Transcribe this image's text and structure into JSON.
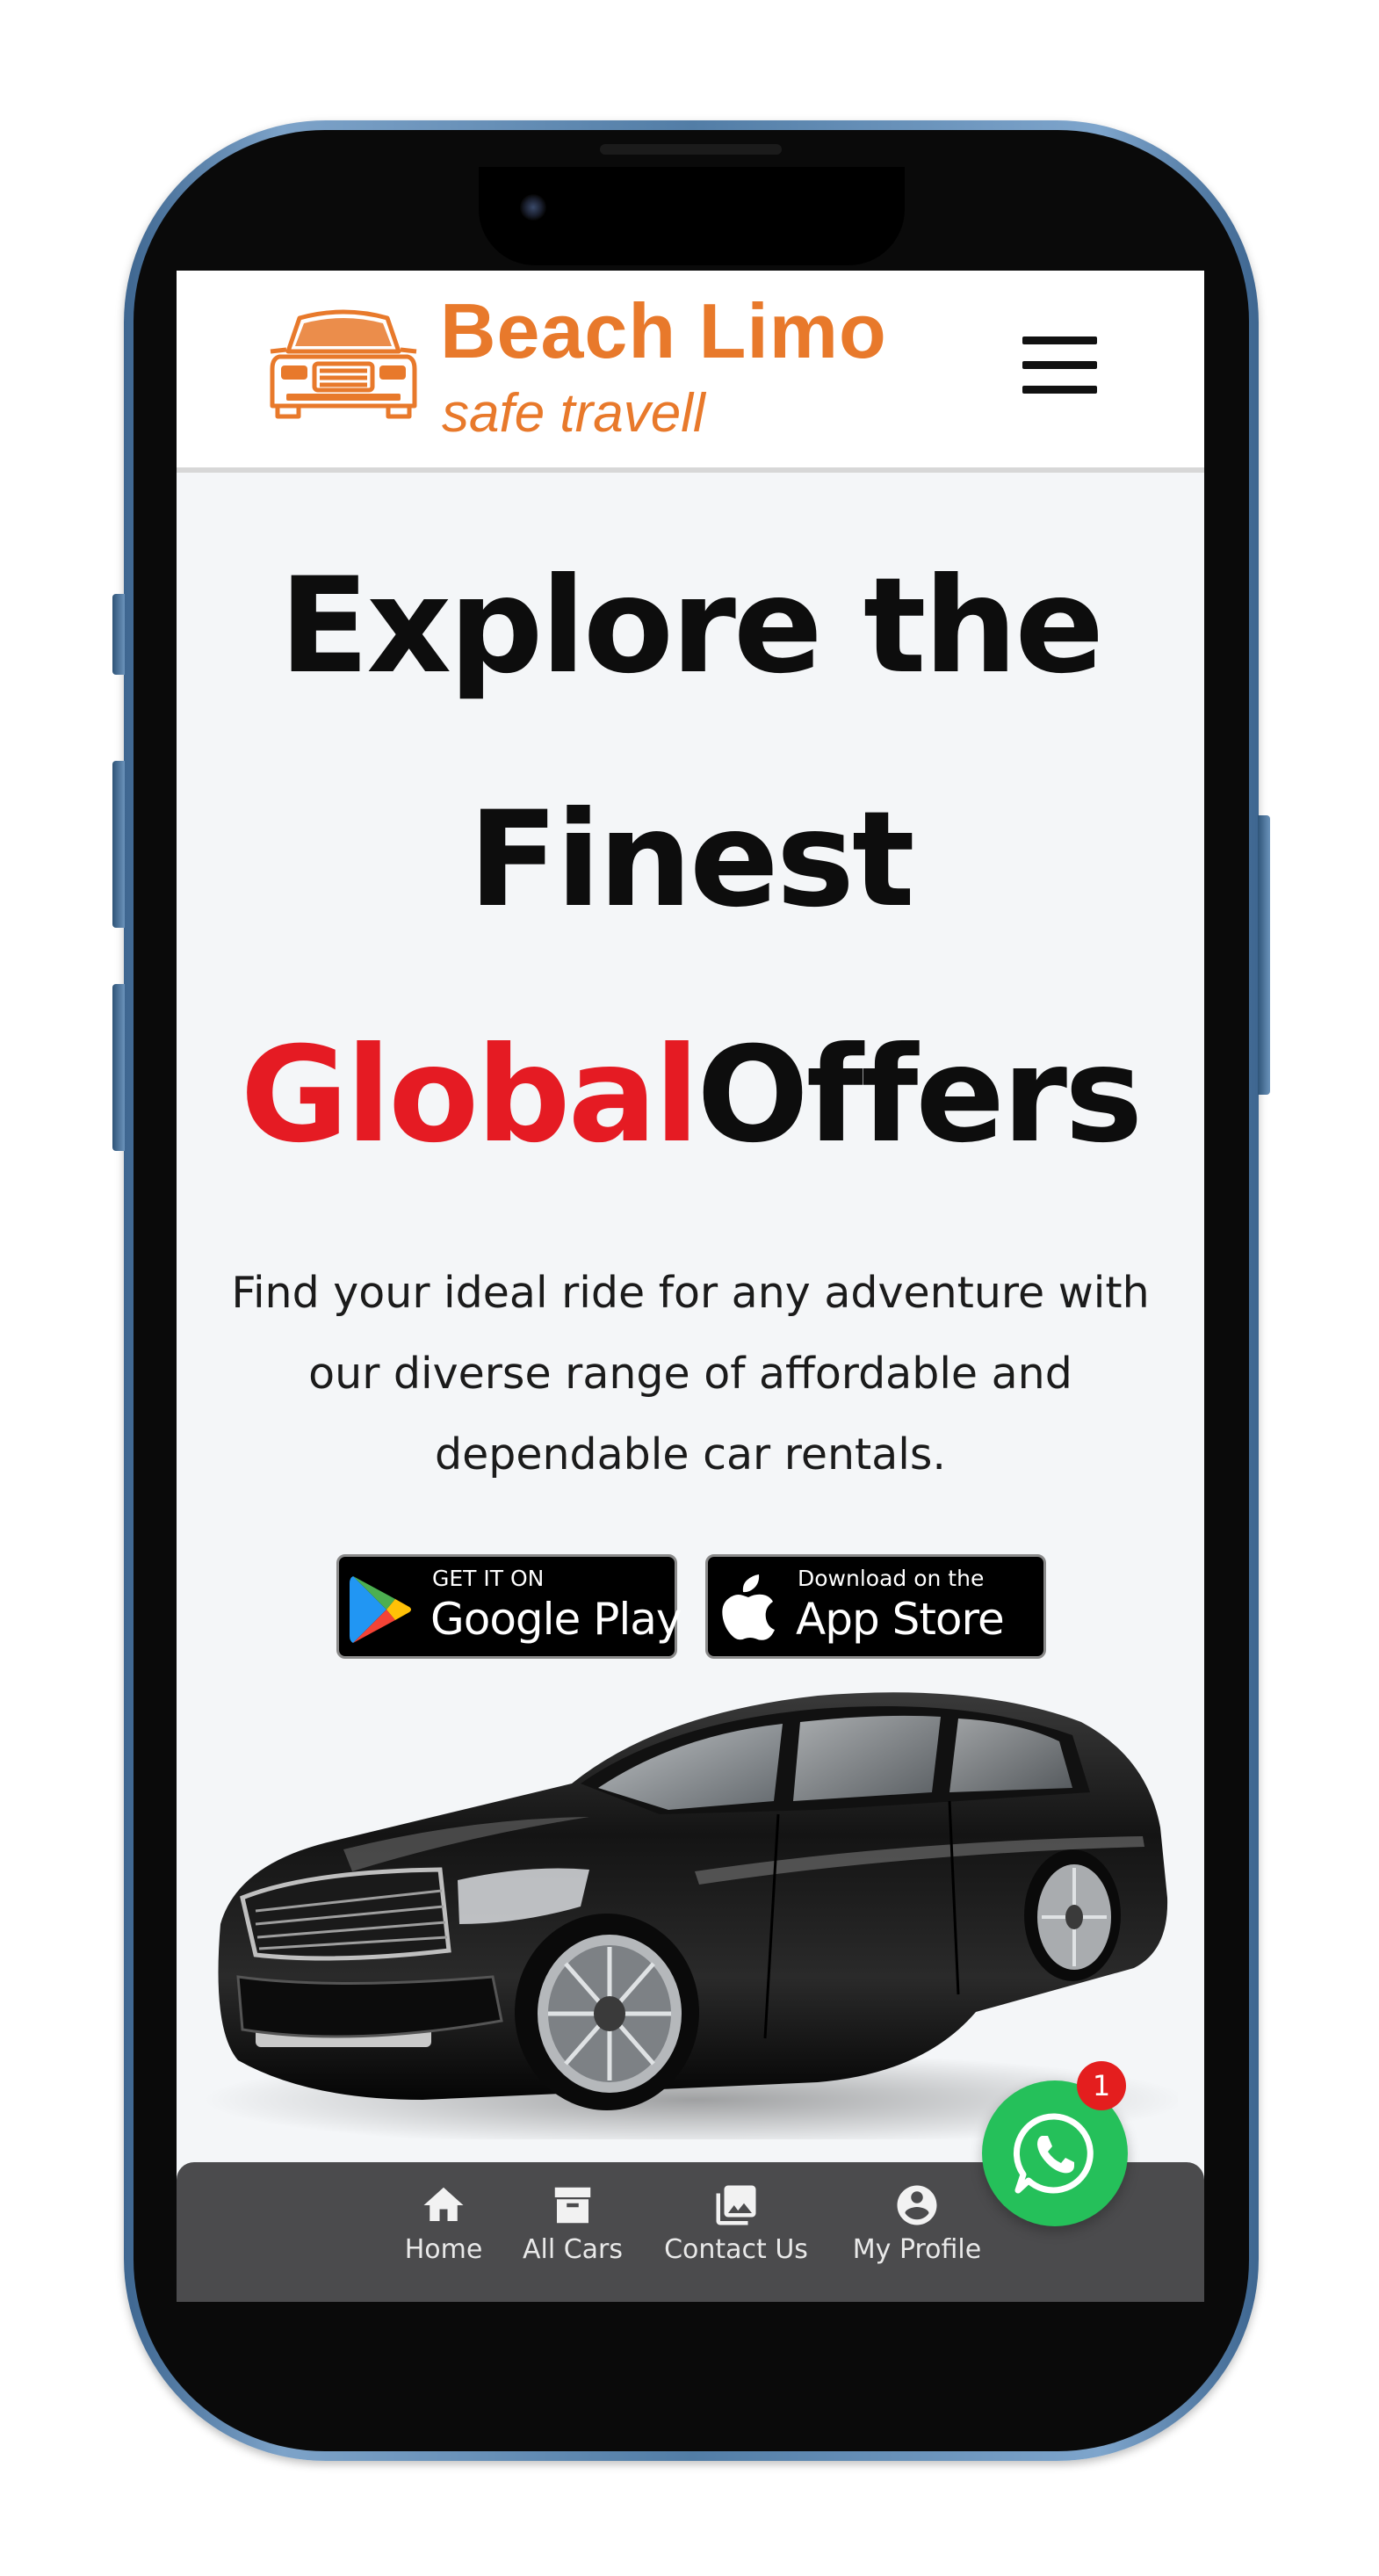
{
  "header": {
    "brand_name": "Beach Limo",
    "tagline": "safe travell",
    "brand_color": "#e8792b"
  },
  "hero": {
    "line1": "Explore the",
    "line2": "Finest",
    "line3_accent": "Global",
    "line3_rest": "Offers",
    "accent_color": "#e51b23",
    "subtitle": "Find your ideal ride for any adventure with our diverse range of affordable and dependable car rentals."
  },
  "store_badges": {
    "google": {
      "small": "GET IT ON",
      "big": "Google Play"
    },
    "apple": {
      "small": "Download on the",
      "big": "App Store"
    }
  },
  "bottom_nav": {
    "items": [
      {
        "label": "Home",
        "icon": "home-icon"
      },
      {
        "label": "All Cars",
        "icon": "archive-icon"
      },
      {
        "label": "Contact Us",
        "icon": "image-icon"
      },
      {
        "label": "My Profile",
        "icon": "account-circle-icon"
      }
    ]
  },
  "whatsapp": {
    "icon": "whatsapp-icon",
    "badge_count": "1",
    "color": "#25c05a"
  }
}
